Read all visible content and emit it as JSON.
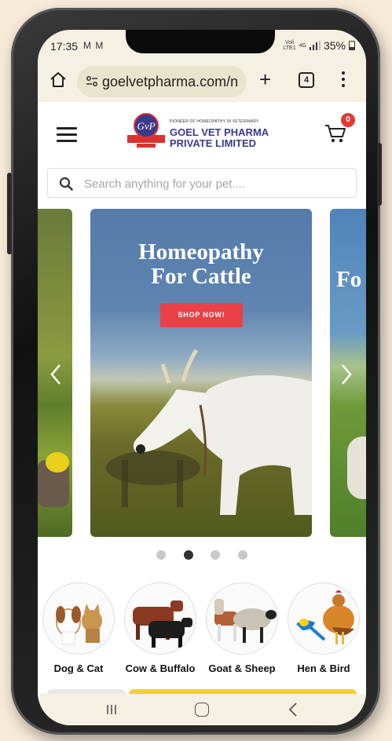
{
  "status_bar": {
    "time": "17:35",
    "notifications": "M M",
    "network_top": "Voli",
    "network_bottom": "LTE1",
    "net_type": "4G",
    "battery": "35%"
  },
  "browser": {
    "url": "goelvetpharma.com/n",
    "tab_count": "4"
  },
  "header": {
    "logo_tagline": "PIONEER OF HOMEOPATHY IN VETERINARY",
    "logo_line1": "GOEL VET PHARMA",
    "logo_line2": "PRIVATE LIMITED",
    "logo_badge_text": "GvP",
    "cart_count": "0"
  },
  "search": {
    "placeholder": "Search anything for your pet...."
  },
  "carousel": {
    "title_line1": "Homeopathy",
    "title_line2": "For Cattle",
    "button_label": "SHOP NOW!",
    "next_peek": "Fo",
    "slide_count": 4,
    "active_index": 1
  },
  "categories": [
    {
      "label": "Dog & Cat",
      "icon": "dog-cat-image"
    },
    {
      "label": "Cow & Buffalo",
      "icon": "cow-buffalo-image"
    },
    {
      "label": "Goat & Sheep",
      "icon": "goat-sheep-image"
    },
    {
      "label": "Hen & Bird",
      "icon": "hen-bird-image"
    }
  ],
  "colors": {
    "brand_navy": "#3a3a8c",
    "accent_red": "#e94147",
    "badge_red": "#e53935",
    "promo_yellow": "#f2d22a"
  }
}
